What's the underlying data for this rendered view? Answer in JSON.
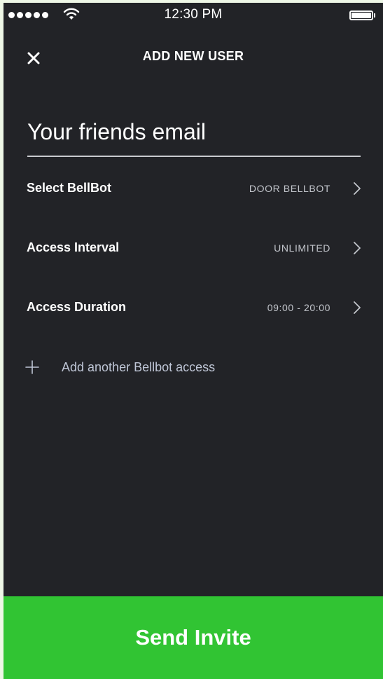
{
  "status_bar": {
    "time": "12:30 PM"
  },
  "header": {
    "title": "ADD NEW USER"
  },
  "email": {
    "placeholder": "Your friends email",
    "value": ""
  },
  "settings": [
    {
      "label": "Select BellBot",
      "value": "DOOR BELLBOT"
    },
    {
      "label": "Access Interval",
      "value": "UNLIMITED"
    },
    {
      "label": "Access Duration",
      "value": "09:00 - 20:00"
    }
  ],
  "add_access": {
    "label": "Add another Bellbot access"
  },
  "send_button": {
    "label": "Send Invite"
  },
  "colors": {
    "background": "#222327",
    "accent_green": "#31c433",
    "text_primary": "#ffffff",
    "text_secondary": "#c3c6cc",
    "page_margin": "#eef7e6"
  },
  "icons": {
    "close": "close-icon",
    "chevron": "chevron-right-icon",
    "plus": "plus-icon",
    "wifi": "wifi-icon",
    "battery": "battery-icon",
    "signal": "signal-dots-icon"
  }
}
